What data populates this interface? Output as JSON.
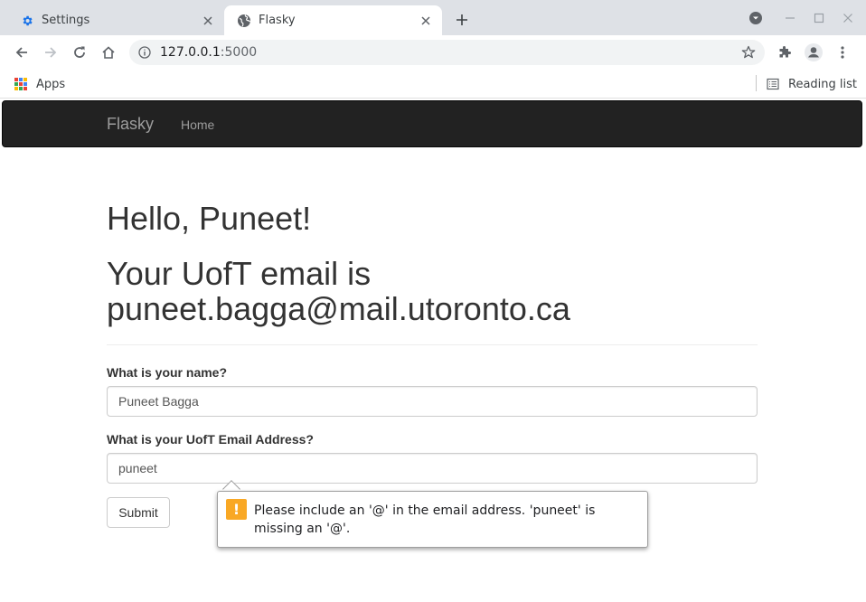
{
  "browser": {
    "tabs": [
      {
        "title": "Settings",
        "icon": "gear-icon",
        "active": false
      },
      {
        "title": "Flasky",
        "icon": "globe-icon",
        "active": true
      }
    ],
    "address": {
      "host": "127.0.0.1",
      "port": ":5000"
    },
    "bookmarks": {
      "apps_label": "Apps",
      "reading_list_label": "Reading list"
    }
  },
  "navbar": {
    "brand": "Flasky",
    "links": [
      {
        "label": "Home"
      }
    ]
  },
  "main": {
    "greeting": "Hello, Puneet!",
    "email_heading": "Your UofT email is puneet.bagga@mail.utoronto.ca",
    "form": {
      "name_label": "What is your name?",
      "name_value": "Puneet Bagga",
      "email_label": "What is your UofT Email Address?",
      "email_value": "puneet",
      "submit_label": "Submit"
    },
    "validation": {
      "message": "Please include an '@' in the email address. 'puneet' is missing an '@'.",
      "color": "#f9a825"
    }
  },
  "colors": {
    "navbar_bg": "#222222",
    "tab_strip": "#dee1e6",
    "settings_icon": "#1a73e8"
  }
}
